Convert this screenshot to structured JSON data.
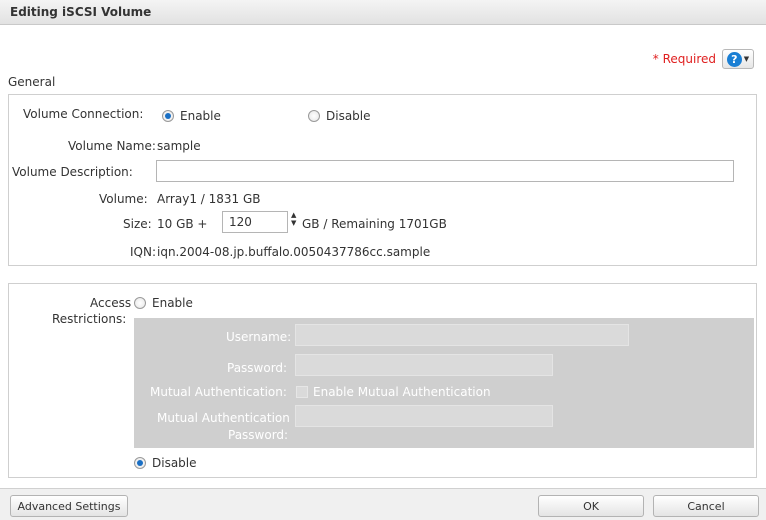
{
  "dialog": {
    "title": "Editing iSCSI Volume"
  },
  "required": {
    "text": "* Required"
  },
  "help": {
    "icon": "question-circle-icon",
    "glyph": "?",
    "caret": "▼"
  },
  "general": {
    "section_title": "General",
    "volume_connection": {
      "label": "Volume Connection:",
      "enable_label": "Enable",
      "disable_label": "Disable",
      "selected": "Enable"
    },
    "volume_name": {
      "label": "Volume Name:",
      "value": "sample"
    },
    "volume_description": {
      "label": "Volume Description:",
      "value": ""
    },
    "volume": {
      "label": "Volume:",
      "value": "Array1 / 1831 GB"
    },
    "size": {
      "label": "Size:",
      "prefix": "10 GB +",
      "input_value": "120",
      "suffix": "GB / Remaining 1701GB"
    },
    "iqn": {
      "label": "IQN:",
      "value": "iqn.2004-08.jp.buffalo.0050437786cc.sample"
    }
  },
  "access": {
    "label_line1": "Access",
    "label_line2": "Restrictions:",
    "enable_label": "Enable",
    "disable_label": "Disable",
    "selected": "Disable",
    "username_label": "Username:",
    "password_label": "Password:",
    "mutual_auth_label": "Mutual Authentication:",
    "mutual_auth_checkbox_label": "Enable Mutual Authentication",
    "mutual_password_label_line1": "Mutual Authentication",
    "mutual_password_label_line2": "Password:"
  },
  "footer": {
    "advanced_settings": "Advanced Settings",
    "ok": "OK",
    "cancel": "Cancel"
  },
  "colors": {
    "accent": "#1a7fd4",
    "required": "#e02020",
    "disabled_panel": "#cfcfcf"
  }
}
